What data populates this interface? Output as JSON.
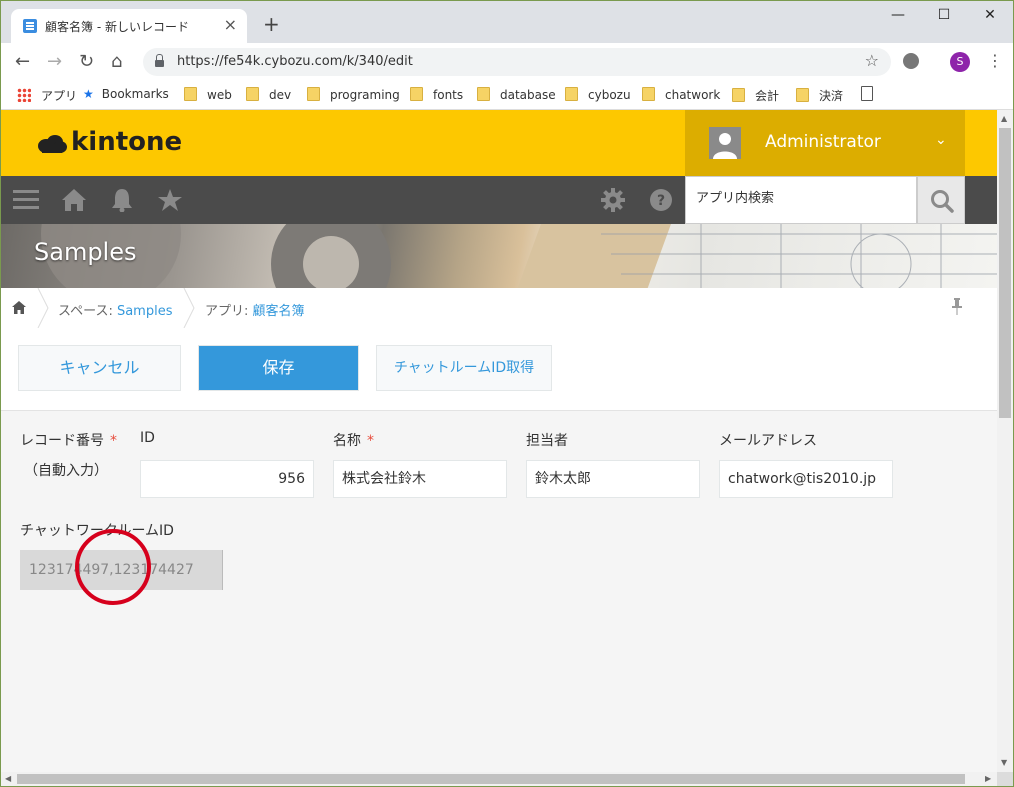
{
  "browser": {
    "tab_title": "顧客名簿 - 新しいレコード",
    "tab_close": "×",
    "new_tab": "+",
    "minimize": "—",
    "maximize": "☐",
    "close": "✕",
    "url": "https://fe54k.cybozu.com/k/340/edit",
    "profile_initial": "S",
    "bookmarks": [
      "アプリ",
      "Bookmarks",
      "web",
      "dev",
      "programing",
      "fonts",
      "database",
      "cybozu",
      "chatwork",
      "会計",
      "決済"
    ]
  },
  "header": {
    "logo": "kintone",
    "user_name": "Administrator"
  },
  "search": {
    "placeholder": "アプリ内検索"
  },
  "banner": {
    "space_name": "Samples"
  },
  "breadcrumb": {
    "space_label": "スペース: ",
    "space_link": "Samples",
    "app_label": "アプリ: ",
    "app_link": "顧客名簿"
  },
  "actions": {
    "cancel": "キャンセル",
    "save": "保存",
    "get_room_id": "チャットルームID取得"
  },
  "form": {
    "record_number_label": "レコード番号",
    "record_number_required": "*",
    "record_number_value": "（自動入力）",
    "id_label": "ID",
    "id_value": "956",
    "name_label": "名称",
    "name_required": "*",
    "name_value": "株式会社鈴木",
    "owner_label": "担当者",
    "owner_value": "鈴木太郎",
    "email_label": "メールアドレス",
    "email_value": "chatwork@tis2010.jp",
    "room_label": "チャットワークルームID",
    "room_value": "123174497,123174427"
  },
  "colors": {
    "header_yellow": "#fdc800",
    "user_area": "#dcad00",
    "nav_dark": "#4b4b4b",
    "accent_blue": "#3498db",
    "required_red": "#e74c3c",
    "annotation_red": "#d6001c"
  },
  "icons": {
    "nav": [
      "menu-icon",
      "home-icon",
      "bell-icon",
      "star-icon"
    ],
    "right": [
      "gear-icon",
      "help-icon",
      "search-icon"
    ]
  }
}
